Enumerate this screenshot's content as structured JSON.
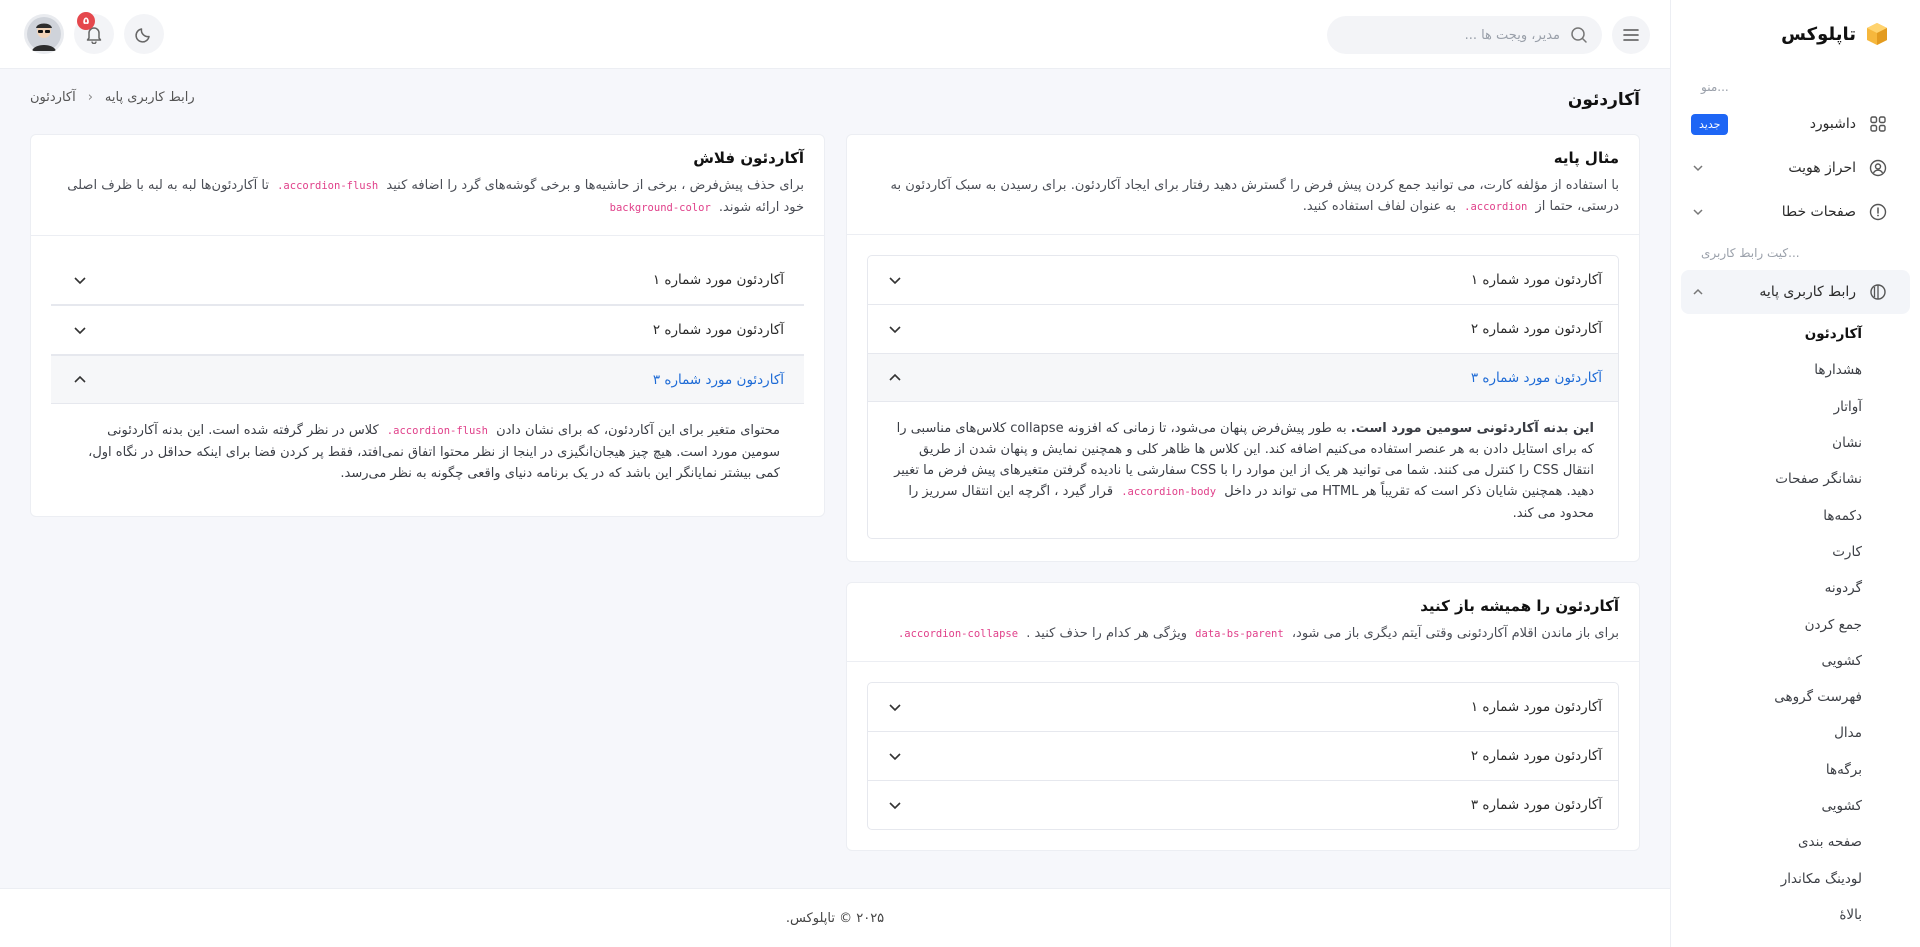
{
  "brand": {
    "name": "تاپلوکس"
  },
  "sidebar": {
    "caption_menu": "منو...",
    "caption_ui": "کیت رابط کاربری...",
    "dashboard": {
      "label": "داشبورد",
      "badge": "جدید"
    },
    "auth": {
      "label": "احراز هویت"
    },
    "errors": {
      "label": "صفحات خطا"
    },
    "basic_ui": {
      "label": "رابط کاربری پایه"
    },
    "sub_items": [
      "آکاردئون",
      "هشدارها",
      "آواتار",
      "نشان",
      "نشانگر صفحات",
      "دکمه‌ها",
      "کارت",
      "گردونه",
      "جمع کردن",
      "کشویی",
      "فهرست گروهی",
      "مدال",
      "برگه‌ها",
      "کشویی",
      "صفحه بندی",
      "لودینگ مکاندار",
      "بالاهٔ"
    ]
  },
  "header": {
    "search_placeholder": "مدیر، ویجت ها ...",
    "notifications_count": "۵"
  },
  "page": {
    "title": "آکاردئون",
    "breadcrumb": [
      "رابط کاربری پایه",
      "آکاردئون"
    ]
  },
  "card_basic": {
    "title": "مثال پایه",
    "desc_1": "با استفاده از مؤلفه کارت، می توانید جمع کردن پیش فرض را گسترش دهید رفتار برای ایجاد آکاردئون. برای رسیدن به سبک آکاردئون به درستی، حتما از",
    "code": ".accordion",
    "desc_2": "به عنوان لفاف استفاده کنید.",
    "items": [
      "آکاردئون مورد شماره ۱",
      "آکاردئون مورد شماره ۲",
      "آکاردئون مورد شماره ۳"
    ],
    "body_bold": "این بدنه آکاردئونی سومین مورد است.",
    "body_1": "به طور پیش‌فرض پنهان می‌شود، تا زمانی که افزونه collapse کلاس‌های مناسبی را که برای استایل دادن به هر عنصر استفاده می‌کنیم اضافه کند. این کلاس ها ظاهر کلی و همچنین نمایش و پنهان شدن از طریق انتقال CSS را کنترل می کنند. شما می توانید هر یک از این موارد را با CSS سفارشی یا نادیده گرفتن متغیرهای پیش فرض ما تغییر دهید. همچنین شایان ذکر است که تقریباً هر HTML می تواند در داخل",
    "body_code": ".accordion-body",
    "body_2": "قرار گیرد ، اگرچه این انتقال سرریز را محدود می کند."
  },
  "card_always_open": {
    "title": "آکاردئون را همیشه باز کنید",
    "desc_1": "برای باز ماندن اقلام آکاردئونی وقتی آیتم دیگری باز می شود،",
    "code_1": "data-bs-parent",
    "desc_2": "ویژگی هر کدام را حذف کنید .",
    "code_2": ".accordion-collapse",
    "items": [
      "آکاردئون مورد شماره ۱",
      "آکاردئون مورد شماره ۲",
      "آکاردئون مورد شماره ۳"
    ]
  },
  "card_flush": {
    "title": "آکاردئون فلاش",
    "desc_1": "برای حذف پیش‌فرض ، برخی از حاشیه‌ها و برخی گوشه‌های گرد را اضافه کنید",
    "code_1": ".accordion-flush",
    "desc_2": "تا آکاردئون‌ها لبه به لبه با ظرف اصلی خود ارائه شوند.",
    "code_2": "background-color",
    "items": [
      "آکاردئون مورد شماره ۱",
      "آکاردئون مورد شماره ۲",
      "آکاردئون مورد شماره ۳"
    ],
    "body_1": "محتوای متغیر برای این آکاردئون، که برای نشان دادن",
    "body_code": ".accordion-flush",
    "body_2": "کلاس در نظر گرفته شده است. این بدنه آکاردئونی سومین مورد است. هیچ چیز هیجان‌انگیزی در اینجا از نظر محتوا اتفاق نمی‌افتد، فقط پر کردن فضا برای اینکه حداقل در نگاه اول، کمی بیشتر نمایانگر این باشد که در یک برنامه دنیای واقعی چگونه به نظر می‌رسد."
  },
  "footer": {
    "text": "۲۰۲۵ © تاپلوکس."
  }
}
